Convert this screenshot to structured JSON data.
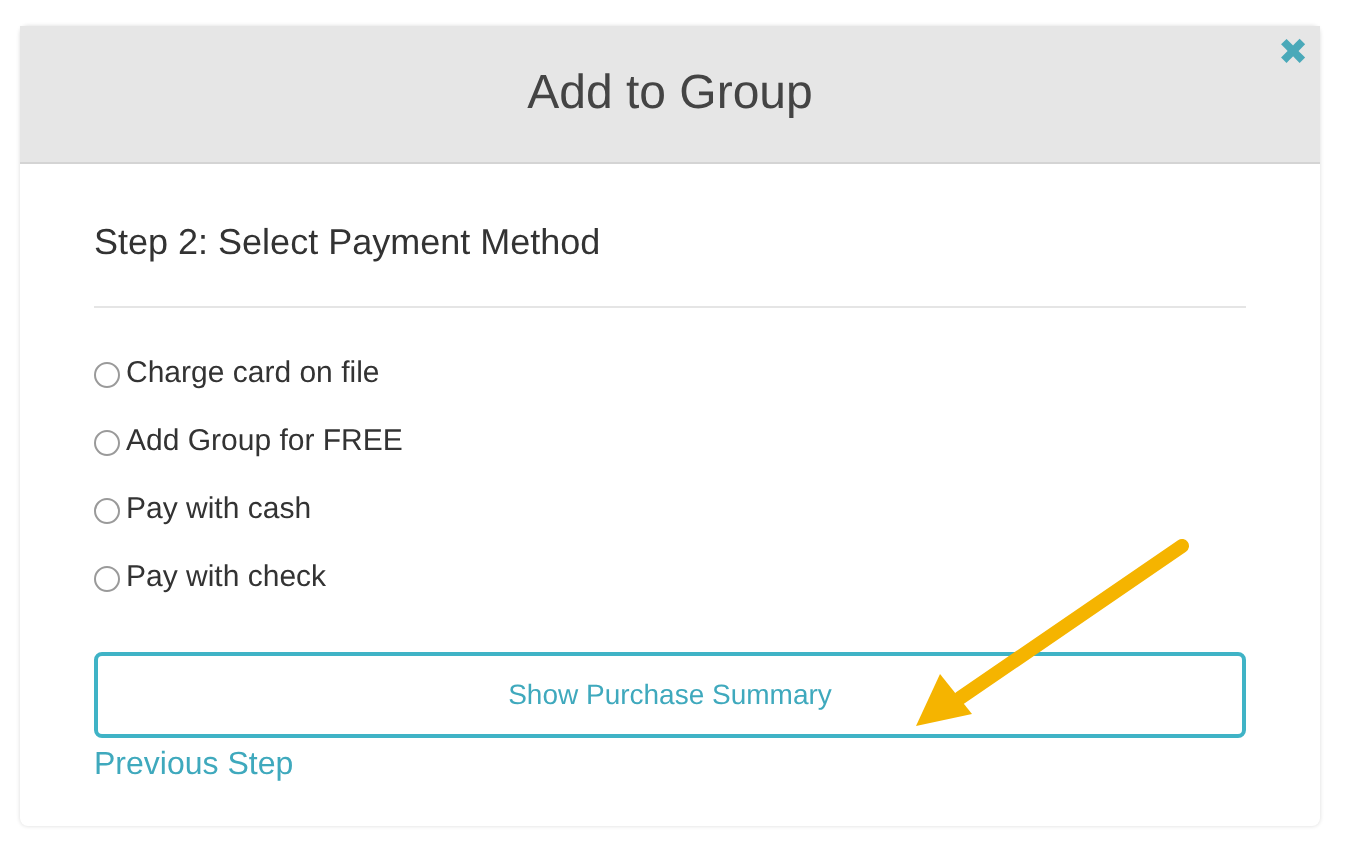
{
  "dialog": {
    "title": "Add to Group",
    "close_label": "✖"
  },
  "step_heading": "Step 2: Select Payment Method",
  "payment_options": [
    {
      "label": "Charge card on file",
      "selected": false
    },
    {
      "label": "Add Group for FREE",
      "selected": false
    },
    {
      "label": "Pay with cash",
      "selected": false
    },
    {
      "label": "Pay with check",
      "selected": false
    }
  ],
  "primary_button": "Show Purchase Summary",
  "back_link": "Previous Step"
}
